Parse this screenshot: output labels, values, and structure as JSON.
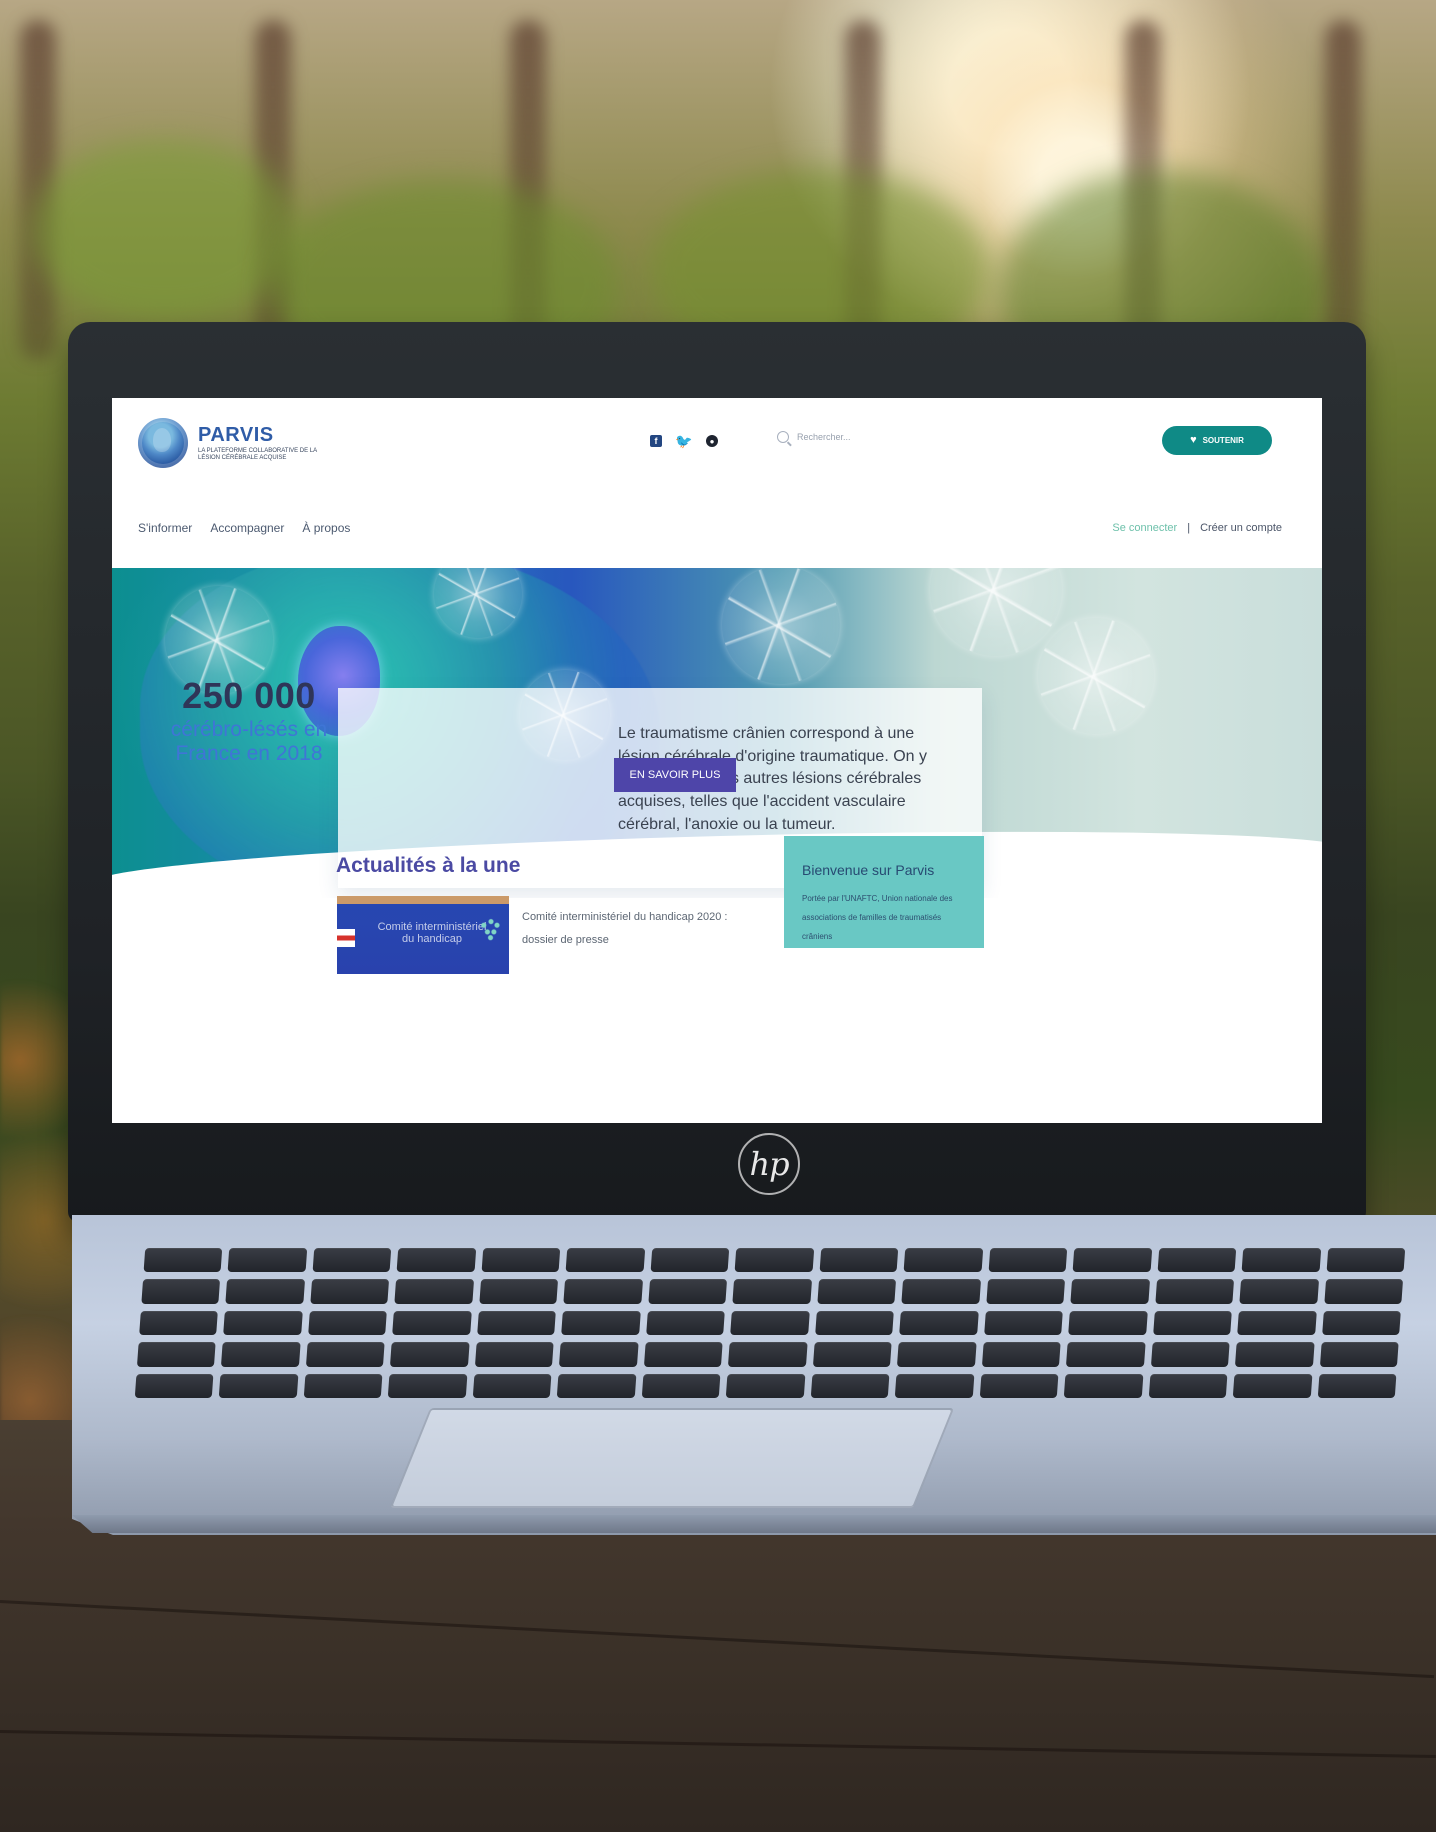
{
  "brand": {
    "name": "PARVIS",
    "tagline": "LA PLATEFORME COLLABORATIVE DE LA LÉSION CÉRÉBRALE ACQUISE"
  },
  "header": {
    "search_placeholder": "Rechercher...",
    "support_label": "SOUTENIR",
    "social_icons": [
      "facebook-icon",
      "twitter-icon",
      "github-icon"
    ]
  },
  "nav": {
    "items": [
      {
        "label": "S'informer"
      },
      {
        "label": "Accompagner"
      },
      {
        "label": "À propos"
      }
    ],
    "login_label": "Se connecter",
    "separator": "|",
    "signup_label": "Créer un compte"
  },
  "hero": {
    "stat_number": "250 000",
    "stat_caption": "cérébro-lésés en France en 2018",
    "description": "Le traumatisme crânien correspond à une lésion cérébrale d'origine traumatique. On y associe aussi les autres lésions cérébrales acquises, telles que l'accident vasculaire cérébral, l'anoxie ou la tumeur.",
    "cta_label": "EN SAVOIR PLUS"
  },
  "news": {
    "title": "Actualités à la une",
    "item_text": "Comité interministériel du handicap 2020 : dossier de presse",
    "thumb_text": "Comité interministériel du handicap"
  },
  "welcome": {
    "title": "Bienvenue sur Parvis",
    "text": "Portée par l'UNAFTC, Union nationale des associations de familles de traumatisés crâniens"
  },
  "device": {
    "logo_text": "hp"
  },
  "colors": {
    "brand_blue": "#2f5ca7",
    "teal": "#0f8a86",
    "purple": "#4e45a9",
    "welcome_bg": "#69c8c4"
  }
}
